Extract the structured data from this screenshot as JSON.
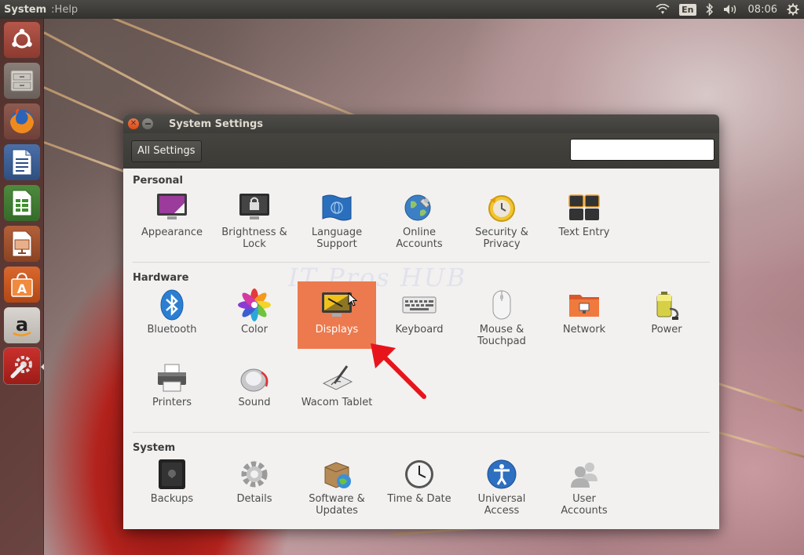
{
  "top_panel": {
    "app_name": "System",
    "menu_help": "Help",
    "lang": "En",
    "clock": "08:06"
  },
  "launcher": {
    "items": [
      {
        "name": "dash-home",
        "icon": "ubuntu-logo-icon"
      },
      {
        "name": "files",
        "icon": "file-cabinet-icon"
      },
      {
        "name": "firefox",
        "icon": "firefox-icon"
      },
      {
        "name": "writer",
        "icon": "document-icon"
      },
      {
        "name": "calc",
        "icon": "spreadsheet-icon"
      },
      {
        "name": "impress",
        "icon": "presentation-icon"
      },
      {
        "name": "software-center",
        "icon": "shopping-bag-icon"
      },
      {
        "name": "amazon",
        "icon": "amazon-icon"
      },
      {
        "name": "system-settings",
        "icon": "wrench-gear-icon"
      }
    ]
  },
  "window": {
    "title": "System Settings",
    "all_settings": "All Settings",
    "search_placeholder": "",
    "watermark": "IT Pros HUB"
  },
  "sections": {
    "personal": {
      "title": "Personal",
      "items": [
        "Appearance",
        "Brightness &\nLock",
        "Language\nSupport",
        "Online\nAccounts",
        "Security &\nPrivacy",
        "Text Entry"
      ]
    },
    "hardware": {
      "title": "Hardware",
      "items": [
        "Bluetooth",
        "Color",
        "Displays",
        "Keyboard",
        "Mouse &\nTouchpad",
        "Network",
        "Power",
        "Printers",
        "Sound",
        "Wacom Tablet"
      ],
      "selected": "Displays"
    },
    "system": {
      "title": "System",
      "items": [
        "Backups",
        "Details",
        "Software &\nUpdates",
        "Time & Date",
        "Universal\nAccess",
        "User\nAccounts"
      ]
    }
  },
  "colors": {
    "selection": "#ec7a4e",
    "arrow": "#e8141b",
    "panel": "#3c3b37"
  }
}
